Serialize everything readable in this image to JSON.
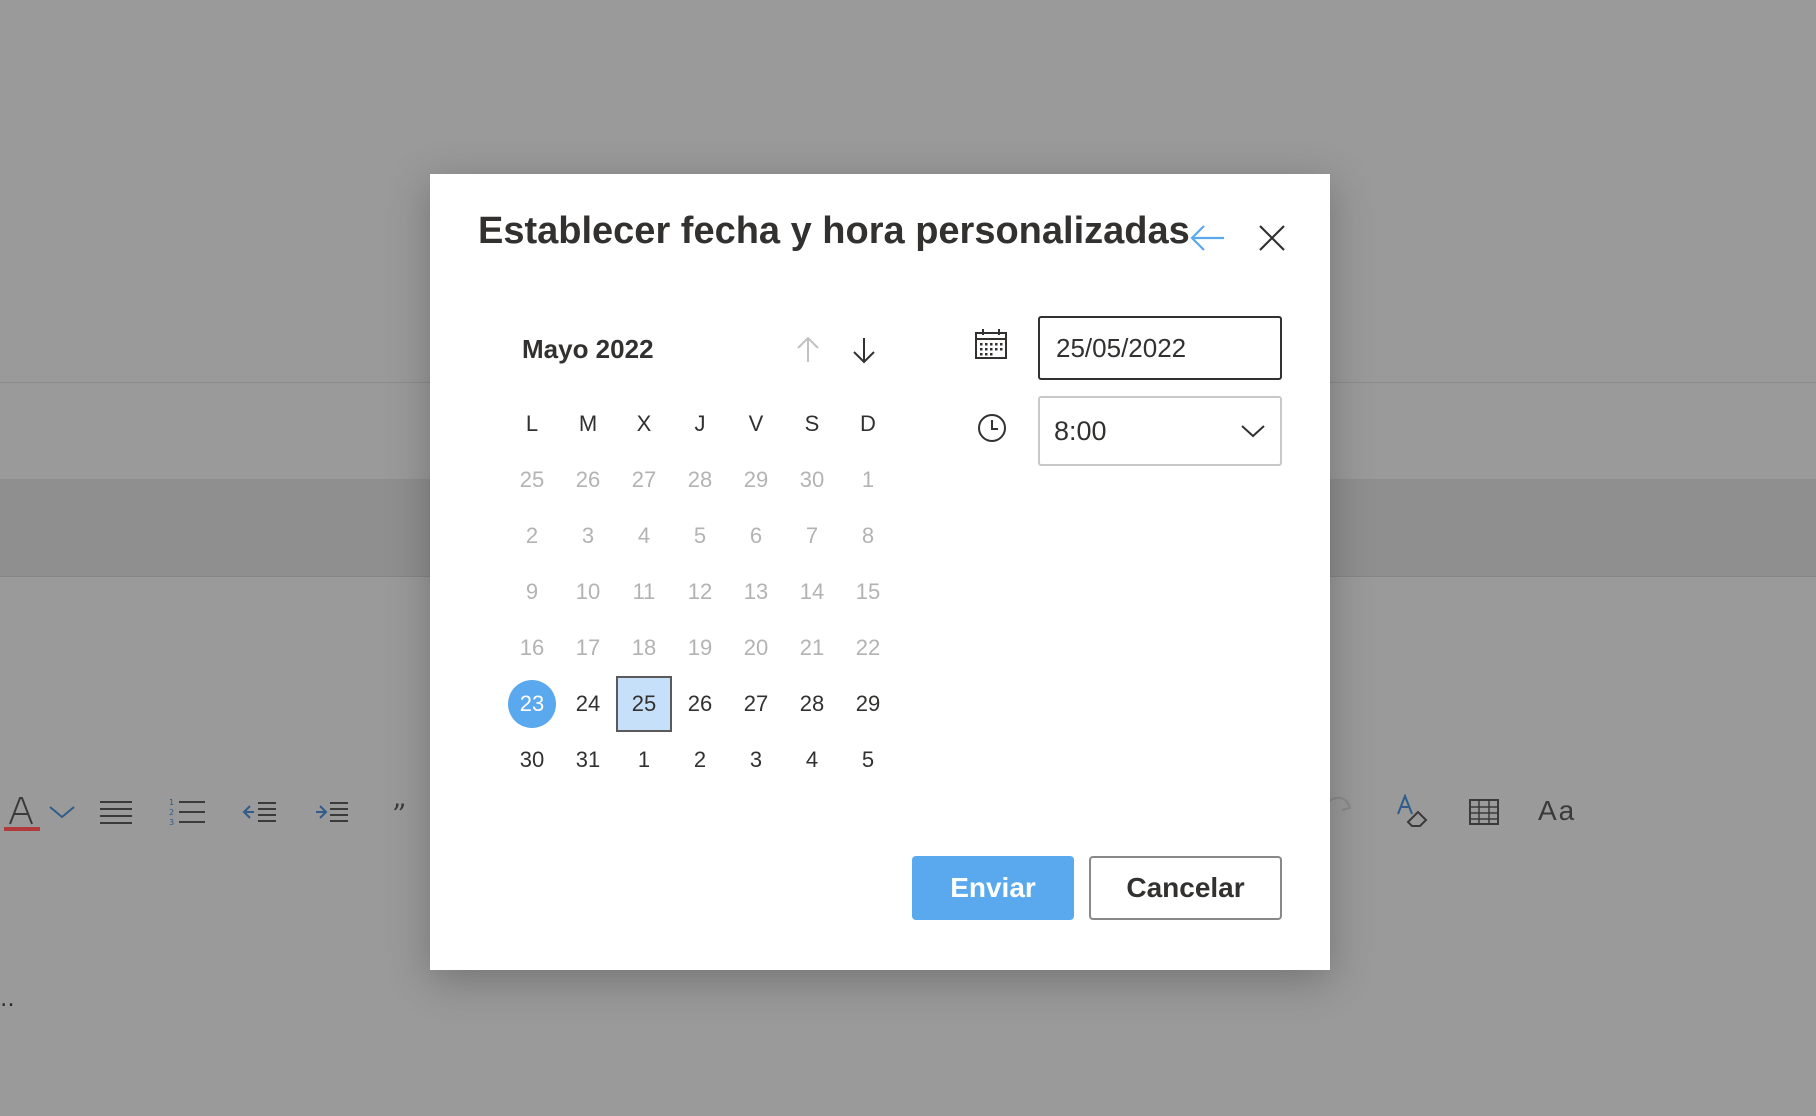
{
  "background": {
    "toolbar_icons": [
      "font-color-icon",
      "chevron-down-icon",
      "bullets-icon",
      "numbering-icon",
      "decrease-indent-icon",
      "increase-indent-icon",
      "quote-icon",
      "redo-icon",
      "clear-formatting-icon",
      "table-icon"
    ],
    "font_size_label": "Aa",
    "dots": "‥"
  },
  "dialog": {
    "title": "Establecer fecha y hora personalizadas",
    "accent_color": "#5aa8ee",
    "calendar": {
      "month_label": "Mayo 2022",
      "weekdays": [
        "L",
        "M",
        "X",
        "J",
        "V",
        "S",
        "D"
      ],
      "weeks": [
        [
          "25",
          "26",
          "27",
          "28",
          "29",
          "30",
          "1"
        ],
        [
          "2",
          "3",
          "4",
          "5",
          "6",
          "7",
          "8"
        ],
        [
          "9",
          "10",
          "11",
          "12",
          "13",
          "14",
          "15"
        ],
        [
          "16",
          "17",
          "18",
          "19",
          "20",
          "21",
          "22"
        ],
        [
          "23",
          "24",
          "25",
          "26",
          "27",
          "28",
          "29"
        ],
        [
          "30",
          "31",
          "1",
          "2",
          "3",
          "4",
          "5"
        ]
      ]
    },
    "date_field": {
      "value": "25/05/2022"
    },
    "time_select": {
      "value": "8:00"
    },
    "send_label": "Enviar",
    "cancel_label": "Cancelar"
  }
}
